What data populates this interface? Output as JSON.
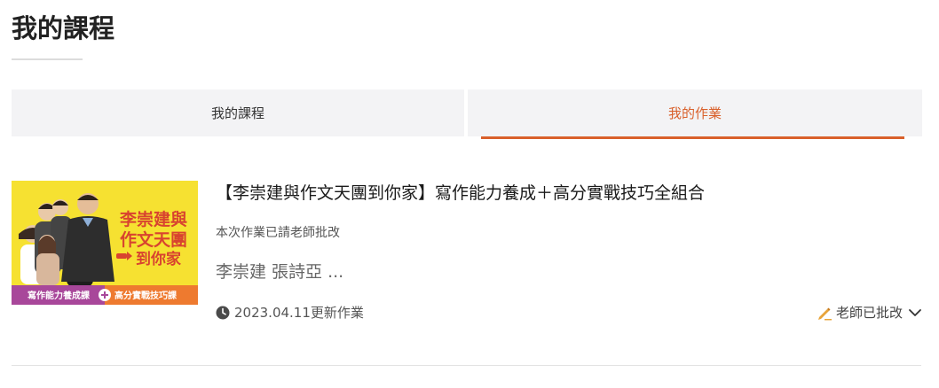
{
  "page": {
    "title": "我的課程"
  },
  "tabs": [
    {
      "label": "我的課程",
      "active": false
    },
    {
      "label": "我的作業",
      "active": true
    }
  ],
  "accent_color": "#d9602b",
  "course": {
    "title": "【李崇建與作文天團到你家】寫作能力養成＋高分實戰技巧全組合",
    "status": "本次作業已請老師批改",
    "teachers": "李崇建 張詩亞 ...",
    "updated": "2023.04.11更新作業",
    "graded_label": "老師已批改",
    "thumbnail": {
      "headline_1": "李崇建與",
      "headline_2": "作文天團",
      "headline_3": "到你家",
      "banner_left": "寫作能力養成課",
      "banner_right": "高分實戰技巧課",
      "bg_color": "#f6e131",
      "banner_left_color": "#a8479a",
      "banner_right_color": "#ee7a2f"
    }
  },
  "icons": {
    "clock": "clock-icon",
    "pencil": "pencil-icon",
    "chevron": "chevron-down-icon"
  }
}
